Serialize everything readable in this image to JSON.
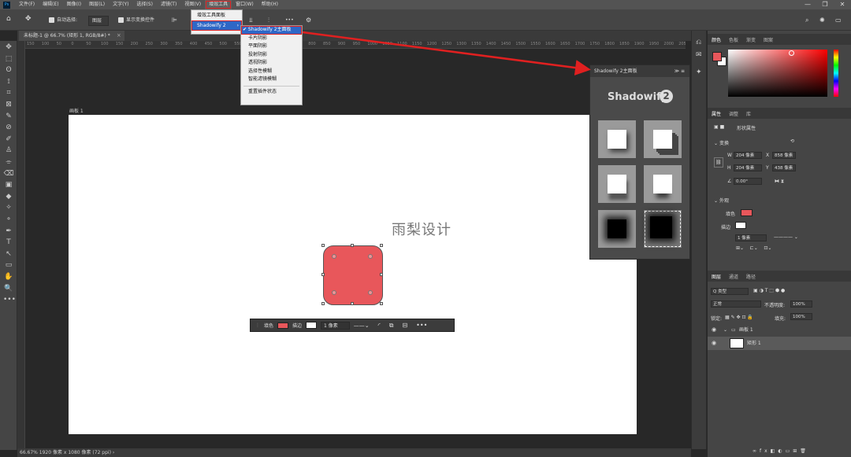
{
  "app": {
    "logo": "Ps"
  },
  "menubar": {
    "items": [
      "文件(F)",
      "编辑(E)",
      "图像(I)",
      "图层(L)",
      "文字(Y)",
      "选择(S)",
      "滤镜(T)",
      "视图(V)",
      "增效工具",
      "窗口(W)",
      "帮助(H)"
    ],
    "active_index": 8,
    "window_controls": [
      "—",
      "❐",
      "✕"
    ]
  },
  "options": {
    "auto_select_label": "自动选择:",
    "auto_select_value": "图层",
    "show_transform_label": "显示变换控件",
    "more": "•••"
  },
  "document": {
    "tab_title": "未标题-1 @ 66.7% (矩形 1, RGB/8#) *",
    "close": "×",
    "artboard_label": "画板 1",
    "watermark": "雨梨设计",
    "status": "66.67%    1920 像素 x 1080 像素 (72 ppi)   ›"
  },
  "ruler": {
    "ticks": [
      "150",
      "100",
      "50",
      "0",
      "50",
      "100",
      "150",
      "200",
      "250",
      "300",
      "350",
      "400",
      "450",
      "500",
      "550",
      "600",
      "650",
      "700",
      "750",
      "800",
      "850",
      "900",
      "950",
      "1000",
      "1050",
      "1100",
      "1150",
      "1200",
      "1250",
      "1300",
      "1350",
      "1400",
      "1450",
      "1500",
      "1550",
      "1600",
      "1650",
      "1700",
      "1750",
      "1800",
      "1850",
      "1900",
      "1950",
      "2000",
      "2050"
    ]
  },
  "plugin_menu": {
    "items": [
      "增效工具面板",
      "Shadowify 2"
    ],
    "submenu_arrow": "›",
    "submenu": [
      "✔ Shadowify 2主面板",
      "卡片阴影",
      "平面阴影",
      "投射阴影",
      "透视阴影",
      "选择性模糊",
      "智能滤镜模糊",
      "重置插件状态"
    ]
  },
  "context_bar": {
    "fill_label": "填色",
    "stroke_label": "描边",
    "stroke_width": "1 像素"
  },
  "shadowify": {
    "title": "Shadowify 2主面板",
    "brand": "Shadowify",
    "badge": "2"
  },
  "color_panel": {
    "tabs": [
      "颜色",
      "色板",
      "渐变",
      "图案"
    ],
    "fg_color": "#e8575b",
    "bg_color": "#ffffff"
  },
  "properties": {
    "tabs": [
      "属性",
      "调整",
      "库"
    ],
    "shape_props": "形状属性",
    "transform_title": "变换",
    "w_label": "W",
    "w_value": "204 像素",
    "x_label": "X",
    "x_value": "858 像素",
    "h_label": "H",
    "h_value": "204 像素",
    "y_label": "Y",
    "y_value": "438 像素",
    "angle_value": "0.00°",
    "appearance_title": "外观",
    "fill_label": "填色",
    "stroke_label": "描边",
    "stroke_width": "1 像素"
  },
  "layers": {
    "tabs": [
      "图层",
      "通道",
      "路径"
    ],
    "filter_type": "Q 类型",
    "blend_mode": "正常",
    "opacity_label": "不透明度:",
    "opacity_value": "100%",
    "lock_label": "锁定:",
    "fill_label": "填充:",
    "fill_value": "100%",
    "rows": [
      {
        "name": "画板 1"
      },
      {
        "name": "矩形 1"
      }
    ],
    "bottom_icons": [
      "∞",
      "fx",
      "◧",
      "◐",
      "▭",
      "⊞",
      "🗑"
    ]
  },
  "tools": [
    "✥",
    "⬚",
    "ʘ",
    "⟟",
    "⌗",
    "⊠",
    "✎",
    "⊘",
    "✐",
    "♙",
    "⌯",
    "⌫",
    "▣",
    "◆",
    "✧",
    "⚬",
    "✒",
    "T",
    "↖",
    "▭",
    "✋",
    "🔍",
    "•••"
  ]
}
